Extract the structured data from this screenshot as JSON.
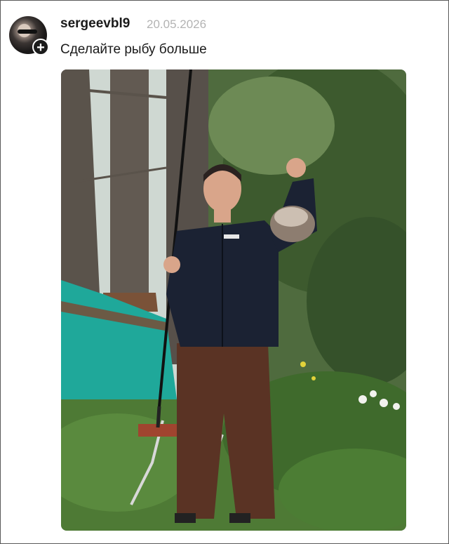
{
  "post": {
    "username": "sergeevbl9",
    "date": "20.05.2026",
    "caption": "Сделайте рыбу больше",
    "follow_icon": "plus-icon",
    "follow_symbol": "+"
  },
  "colors": {
    "username": "#1a1a1a",
    "date": "#b3b3b3",
    "frame_border": "#5a5a5a",
    "follow_button": "#1b1b1b"
  }
}
